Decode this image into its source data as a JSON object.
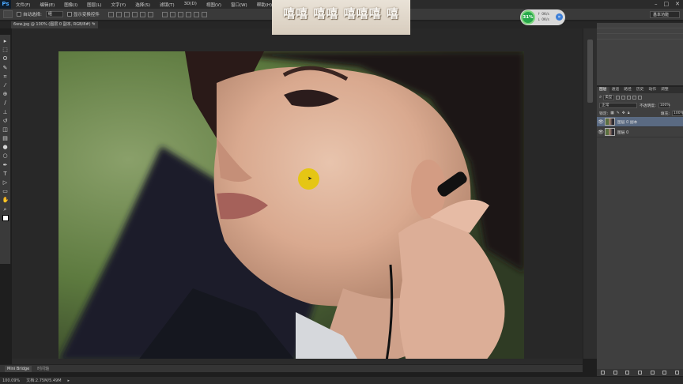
{
  "app": {
    "logo": "Ps",
    "menu": [
      "文件(F)",
      "编辑(E)",
      "图像(I)",
      "图层(L)",
      "文字(Y)",
      "选择(S)",
      "滤镜(T)",
      "3D(D)",
      "视图(V)",
      "窗口(W)",
      "帮助(H)"
    ],
    "window_controls": [
      "–",
      "□",
      "✕"
    ]
  },
  "options_bar": {
    "auto_select_label": "自动选择:",
    "auto_select_value": "组",
    "show_transform_label": "显示变换控件",
    "workspace": "基本功能"
  },
  "overlay_banner": {
    "text": "嘻嘻 嘻嘻  嘻嘻嘻 嘻"
  },
  "net_widget": {
    "percent": "31%",
    "upload": "0K/s",
    "download": "0K/s",
    "accent": "#27a84a"
  },
  "document_tab": {
    "title": "6ww.jpg @ 100% (图层 0 副本, RGB/8#) *",
    "close": "×"
  },
  "toolbox": {
    "icons": [
      "move-icon",
      "marquee-icon",
      "lasso-icon",
      "quick-select-icon",
      "crop-icon",
      "eyedropper-icon",
      "healing-icon",
      "brush-icon",
      "stamp-icon",
      "history-brush-icon",
      "eraser-icon",
      "gradient-icon",
      "blur-icon",
      "dodge-icon",
      "pen-icon",
      "type-icon",
      "path-select-icon",
      "shape-icon",
      "hand-icon",
      "zoom-icon"
    ],
    "glyphs": [
      "▸",
      "⬚",
      "ʘ",
      "✎",
      "⌗",
      "⁄",
      "⊕",
      "/",
      "⊥",
      "↺",
      "◫",
      "▤",
      "●",
      "○",
      "✒",
      "T",
      "▷",
      "▭",
      "✋",
      "⌕"
    ]
  },
  "layers_panel": {
    "tabs": [
      "图层",
      "通道",
      "路径",
      "历史",
      "动作",
      "调整"
    ],
    "filter_label": "类型",
    "blend_mode": "正常",
    "opacity_label": "不透明度:",
    "opacity_value": "100%",
    "lock_label": "锁定:",
    "fill_label": "填充:",
    "fill_value": "100%",
    "layers": [
      {
        "name": "图层 0 副本",
        "selected": true
      },
      {
        "name": "图层 0",
        "selected": false
      }
    ]
  },
  "mini_bridge": {
    "tabs": [
      "Mini Bridge",
      "时间轴"
    ]
  },
  "status": {
    "zoom": "100.09%",
    "doc": "文档:2.75M/5.49M"
  }
}
